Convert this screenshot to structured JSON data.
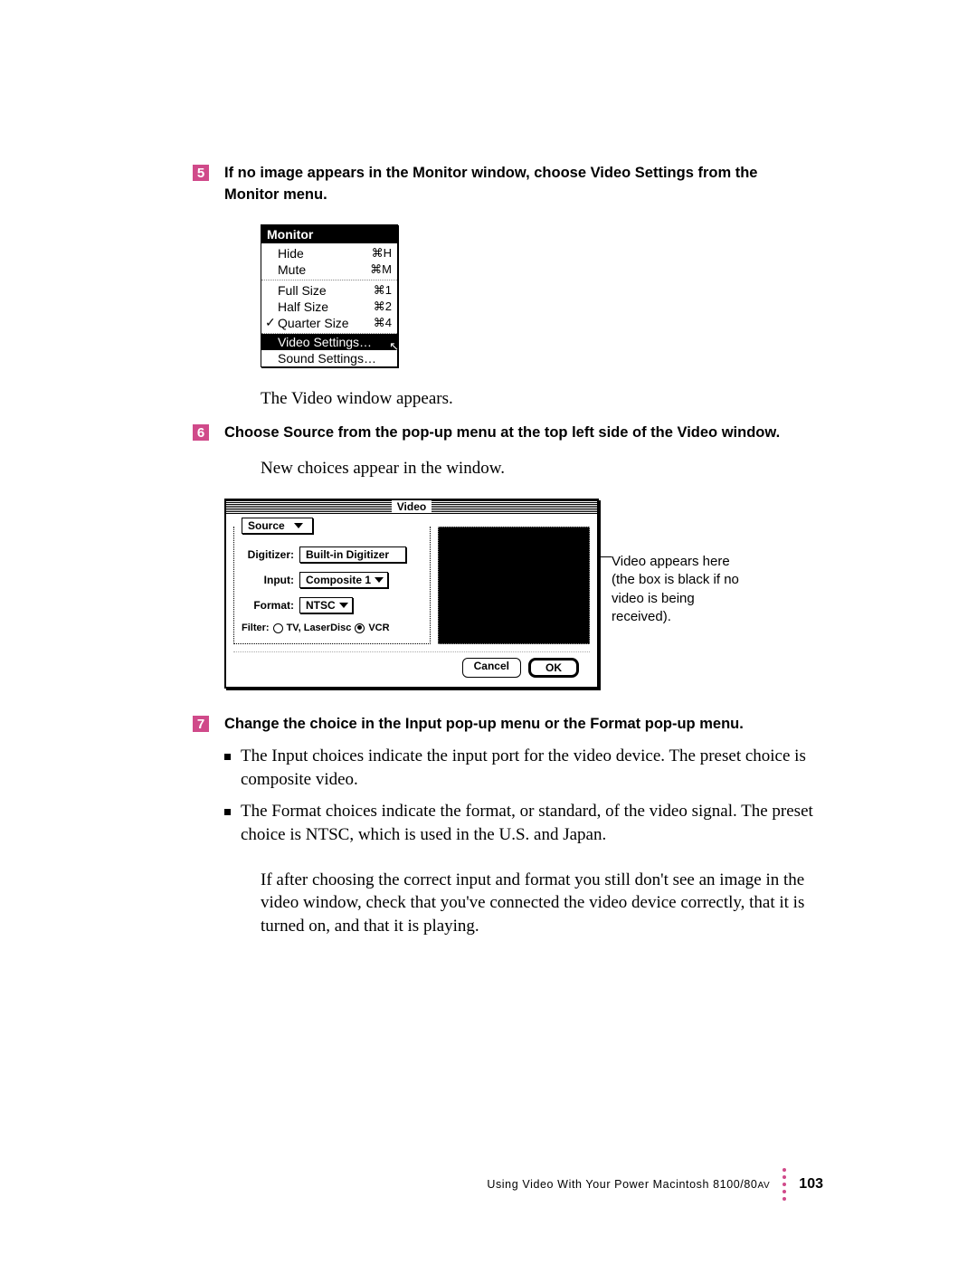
{
  "steps": {
    "s5": {
      "num": "5",
      "text": "If no image appears in the Monitor window, choose Video Settings from the Monitor menu."
    },
    "s6": {
      "num": "6",
      "text": "Choose Source from the pop-up menu at the top left side of the Video window."
    },
    "s7": {
      "num": "7",
      "text": "Change the choice in the Input pop-up menu or the Format pop-up menu."
    }
  },
  "body": {
    "p1": "The Video window appears.",
    "p2": "New choices appear in the window.",
    "b1": "The Input choices indicate the input port for the video device. The preset choice is composite video.",
    "b2": "The Format choices indicate the format, or standard, of the video signal. The preset choice is NTSC, which is used in the U.S. and Japan.",
    "p3": "If after choosing the correct input and format you still don't see an image in the video window, check that you've connected the video device correctly, that it is turned on, and that it is playing."
  },
  "menu": {
    "title": "Monitor",
    "hide": "Hide",
    "hide_sc": "⌘H",
    "mute": "Mute",
    "mute_sc": "⌘M",
    "full": "Full Size",
    "full_sc": "⌘1",
    "half": "Half Size",
    "half_sc": "⌘2",
    "quarter": "Quarter Size",
    "quarter_sc": "⌘4",
    "video": "Video Settings…",
    "sound": "Sound Settings…"
  },
  "video": {
    "title": "Video",
    "groupbox": "Source",
    "digitizer_label": "Digitizer:",
    "digitizer_value": "Built-in Digitizer",
    "input_label": "Input:",
    "input_value": "Composite 1",
    "format_label": "Format:",
    "format_value": "NTSC",
    "filter_label": "Filter:",
    "filter_opt1": "TV, LaserDisc",
    "filter_opt2": "VCR",
    "cancel": "Cancel",
    "ok": "OK"
  },
  "callout": "Video appears here (the box is black if no video is being received).",
  "footer": {
    "text1": "Using Video With Your Power Macintosh 8100/80",
    "text2": "AV",
    "page": "103"
  }
}
